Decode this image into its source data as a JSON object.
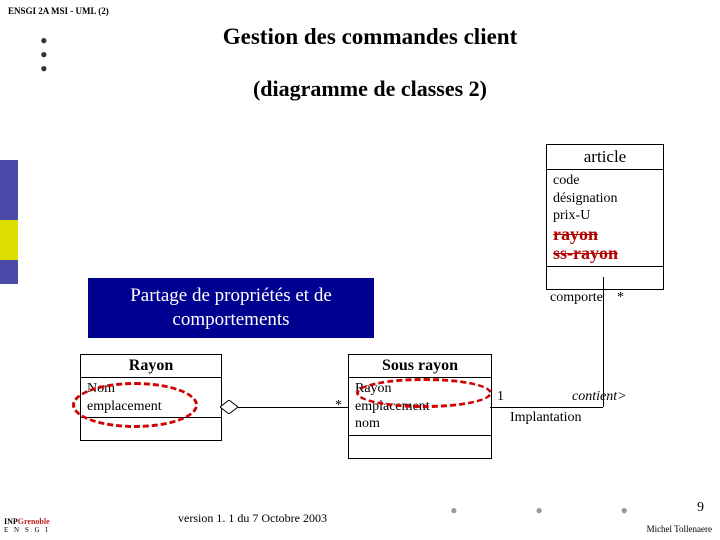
{
  "header": "ENSGI 2A MSI - UML (2)",
  "title": "Gestion des commandes client",
  "subtitle": "(diagramme de classes 2)",
  "classes": {
    "article": {
      "name": "article",
      "attrs": [
        "code",
        "désignation",
        "prix-U"
      ],
      "removed": [
        "rayon",
        "ss-rayon"
      ]
    },
    "rayon": {
      "name": "Rayon",
      "attrs": [
        "Nom",
        "emplacement"
      ]
    },
    "sousrayon": {
      "name": "Sous rayon",
      "attrs": [
        "Rayon",
        "emplacement",
        "nom"
      ]
    }
  },
  "callout": "Partage de propriétés et de comportements",
  "assoc": {
    "comporte": "comporte",
    "comporte_mult": "*",
    "contient": "contient>",
    "contient_left": "*",
    "contient_right": "1",
    "implantation": "Implantation"
  },
  "footer": {
    "version": "version 1. 1 du 7 Octobre 2003",
    "author": "Michel Tollenaere",
    "page": "9"
  }
}
